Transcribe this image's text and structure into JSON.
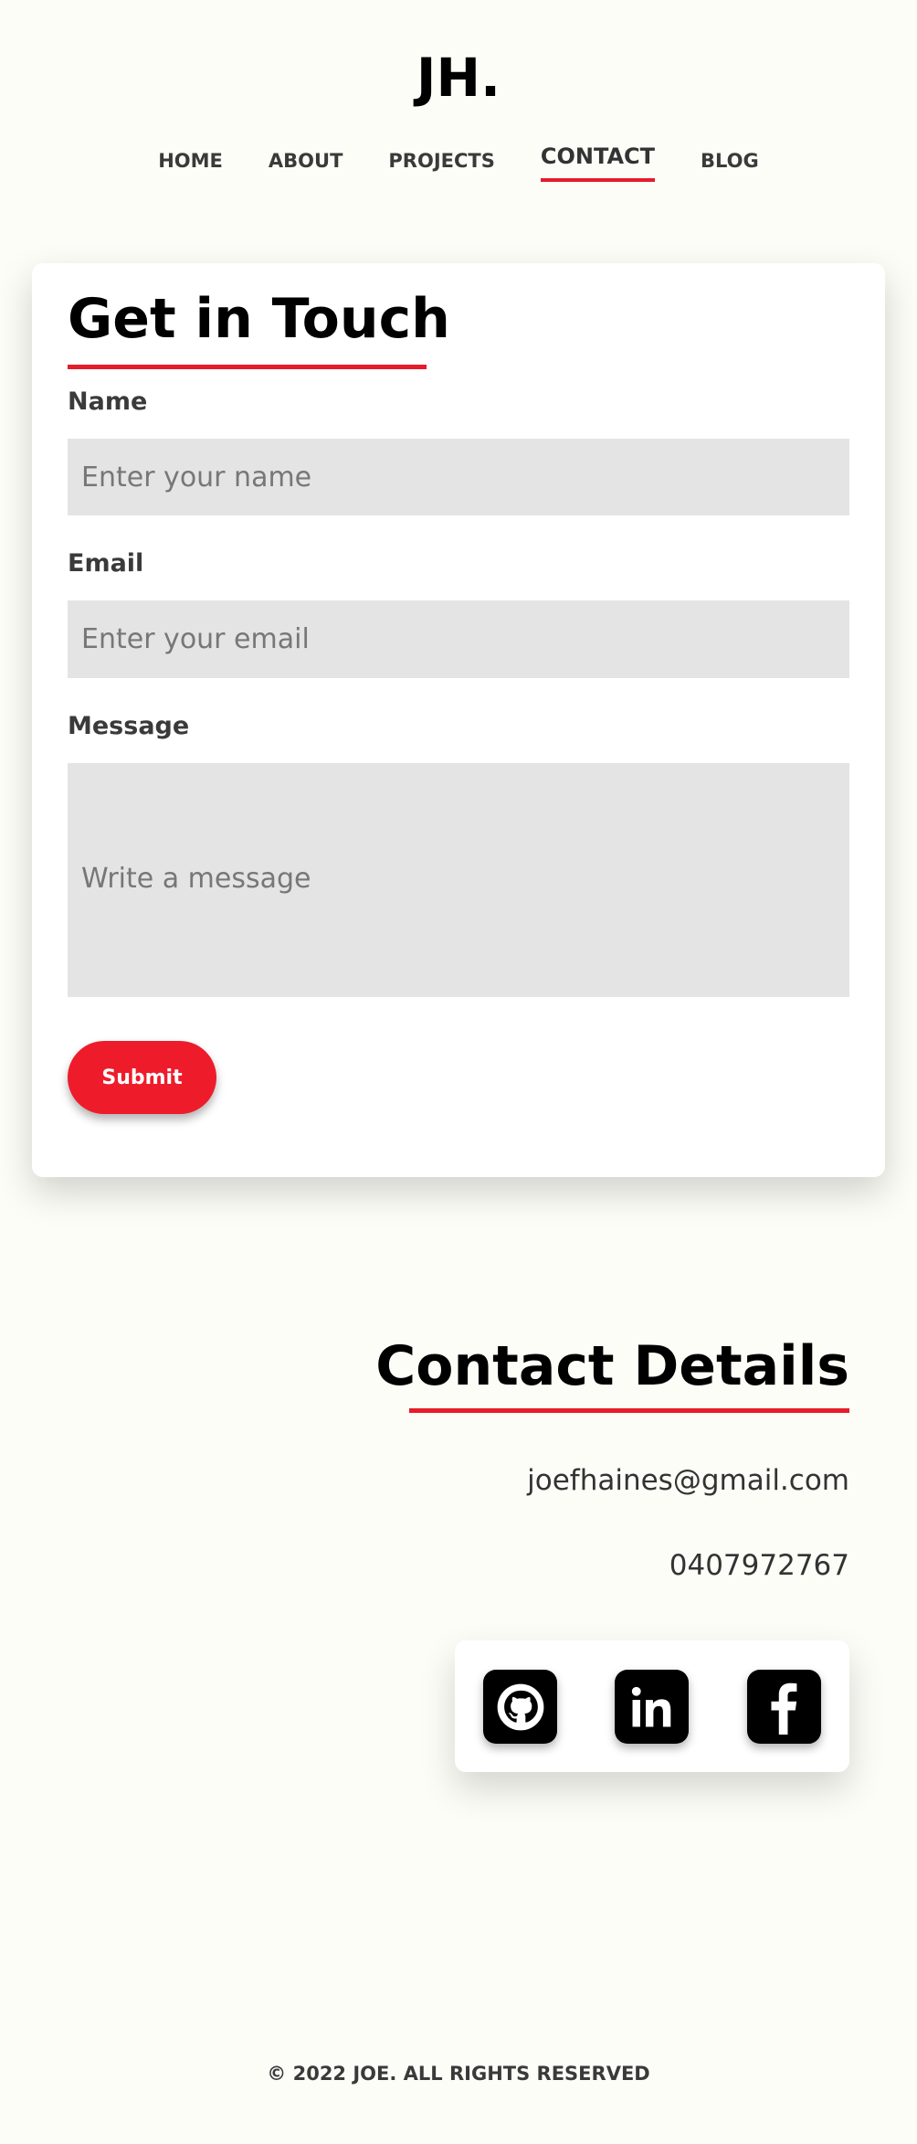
{
  "brand": {
    "logo": "JH."
  },
  "nav": {
    "items": [
      {
        "label": "HOME",
        "active": false
      },
      {
        "label": "ABOUT",
        "active": false
      },
      {
        "label": "PROJECTS",
        "active": false
      },
      {
        "label": "CONTACT",
        "active": true
      },
      {
        "label": "BLOG",
        "active": false
      }
    ]
  },
  "form": {
    "title": "Get in Touch",
    "name_label": "Name",
    "name_placeholder": "Enter your name",
    "name_value": "",
    "email_label": "Email",
    "email_placeholder": "Enter your email",
    "email_value": "",
    "message_label": "Message",
    "message_placeholder": "Write a message",
    "message_value": "",
    "submit_label": "Submit"
  },
  "details": {
    "title": "Contact Details",
    "email": "joefhaines@gmail.com",
    "phone": "0407972767",
    "social": [
      {
        "icon": "github-icon"
      },
      {
        "icon": "linkedin-icon"
      },
      {
        "icon": "facebook-icon"
      }
    ]
  },
  "footer": {
    "text": "© 2022 JOE. ALL RIGHTS RESERVED"
  },
  "colors": {
    "accent": "#e51c2a",
    "button": "#ee1c2b",
    "background": "#fdfdf8",
    "field": "#e4e4e4"
  }
}
